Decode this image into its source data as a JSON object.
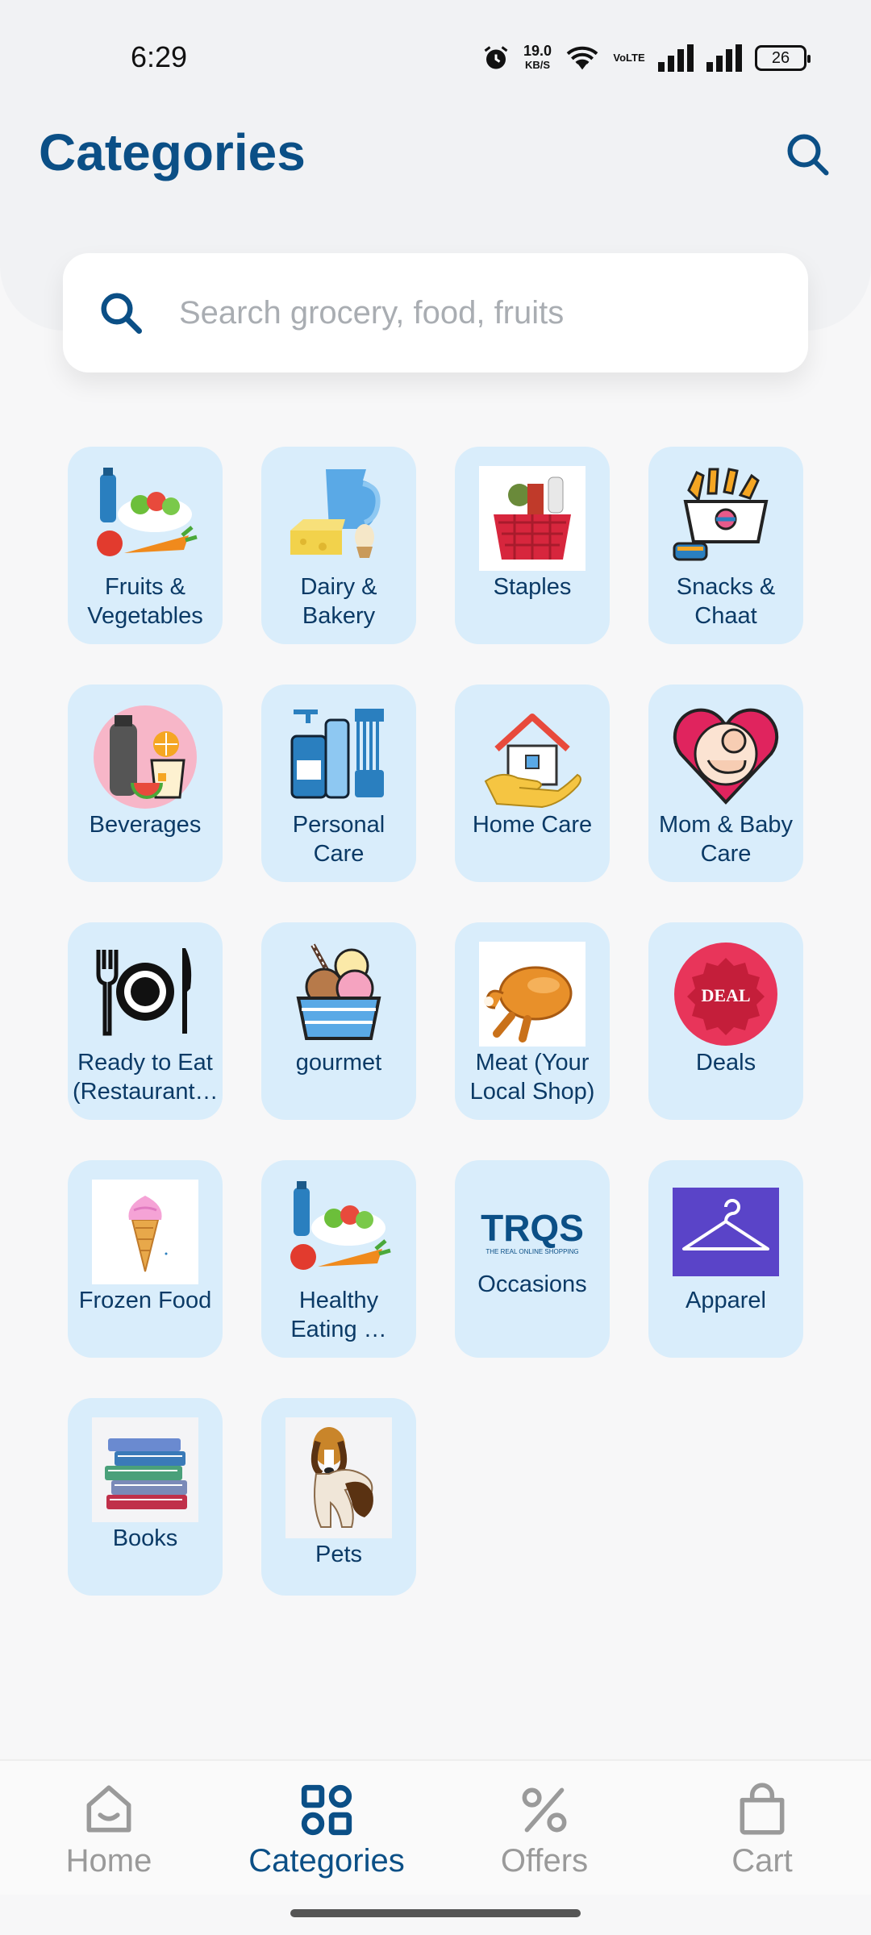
{
  "status_bar": {
    "time": "6:29",
    "net_speed": "19.0",
    "net_unit": "KB/S",
    "volte": "VoLTE",
    "battery": "26",
    "icons": [
      "alarm-icon",
      "wifi-icon",
      "volte-icon",
      "signal-icon",
      "signal-icon",
      "battery-icon"
    ]
  },
  "header": {
    "title": "Categories",
    "search_icon": "search-icon"
  },
  "search": {
    "placeholder": "Search grocery, food, fruits"
  },
  "categories": [
    {
      "label": "Fruits & Vegetables",
      "icon": "fruits-vegetables-icon"
    },
    {
      "label": "Dairy & Bakery",
      "icon": "dairy-bakery-icon"
    },
    {
      "label": "Staples",
      "icon": "staples-basket-icon"
    },
    {
      "label": "Snacks & Chaat",
      "icon": "snacks-icon"
    },
    {
      "label": "Beverages",
      "icon": "beverages-icon"
    },
    {
      "label": "Personal Care",
      "icon": "personal-care-icon"
    },
    {
      "label": "Home Care",
      "icon": "home-care-icon"
    },
    {
      "label": "Mom & Baby Care",
      "icon": "mom-baby-icon"
    },
    {
      "label": "Ready to Eat (Restaurant…",
      "icon": "cutlery-plate-icon"
    },
    {
      "label": "gourmet",
      "icon": "ice-cream-bowl-icon"
    },
    {
      "label": "Meat (Your Local Shop)",
      "icon": "roast-chicken-icon"
    },
    {
      "label": "Deals",
      "icon": "deal-badge-icon",
      "badge_text": "DEAL"
    },
    {
      "label": "Frozen Food",
      "icon": "ice-cream-cone-icon"
    },
    {
      "label": "Healthy Eating …",
      "icon": "fruits-vegetables-icon"
    },
    {
      "label": "Occasions",
      "icon": "tros-logo-icon",
      "logo_text": "TRQS",
      "logo_sub": "THE REAL ONLINE SHOPPING"
    },
    {
      "label": "Apparel",
      "icon": "hanger-icon"
    },
    {
      "label": "Books",
      "icon": "books-icon"
    },
    {
      "label": "Pets",
      "icon": "dog-icon"
    }
  ],
  "bottom_nav": [
    {
      "label": "Home",
      "icon": "home-icon",
      "active": false
    },
    {
      "label": "Categories",
      "icon": "categories-grid-icon",
      "active": true
    },
    {
      "label": "Offers",
      "icon": "percent-icon",
      "active": false
    },
    {
      "label": "Cart",
      "icon": "shopping-bag-icon",
      "active": false
    }
  ],
  "colors": {
    "accent": "#0b4f86",
    "tile_bg": "#d9edfb",
    "inactive": "#9a9a9a"
  }
}
